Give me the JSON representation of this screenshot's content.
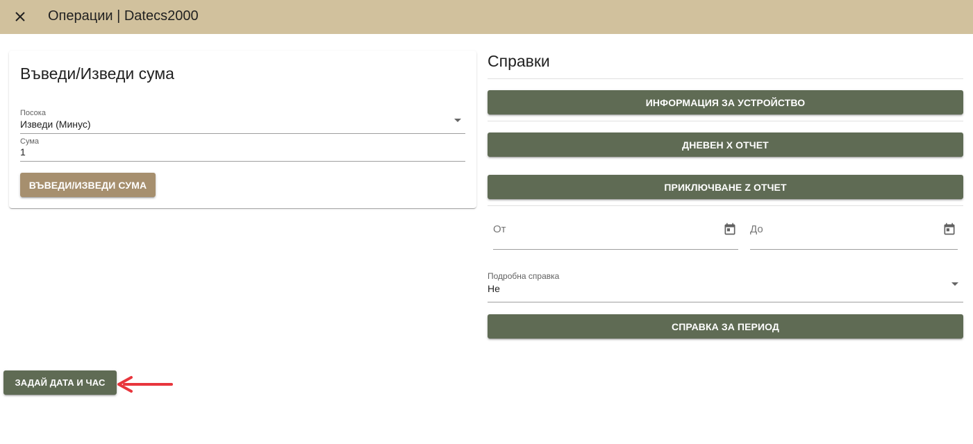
{
  "header": {
    "title": "Операции | Datecs2000",
    "close_icon": "close-icon"
  },
  "cash_card": {
    "title": "Въведи/Изведи сума",
    "direction": {
      "label": "Посока",
      "value": "Изведи (Минус)"
    },
    "amount": {
      "label": "Сума",
      "value": "1"
    },
    "submit_label": "ВЪВЕДИ/ИЗВЕДИ СУМА"
  },
  "reports": {
    "title": "Справки",
    "device_info_label": "ИНФОРМАЦИЯ ЗА УСТРОЙСТВО",
    "daily_x_label": "ДНЕВЕН X ОТЧЕТ",
    "close_z_label": "ПРИКЛЮЧВАНЕ Z ОТЧЕТ",
    "from": {
      "placeholder": "От"
    },
    "to": {
      "placeholder": "До"
    },
    "detailed": {
      "label": "Подробна справка",
      "value": "Не"
    },
    "period_label": "СПРАВКА ЗА ПЕРИОД"
  },
  "set_datetime_label": "ЗАДАЙ ДАТА И ЧАС",
  "colors": {
    "header": "#d1c19d",
    "primary": "#5f6b54",
    "accent": "#a68f6e",
    "annotation": "#e8363d"
  }
}
